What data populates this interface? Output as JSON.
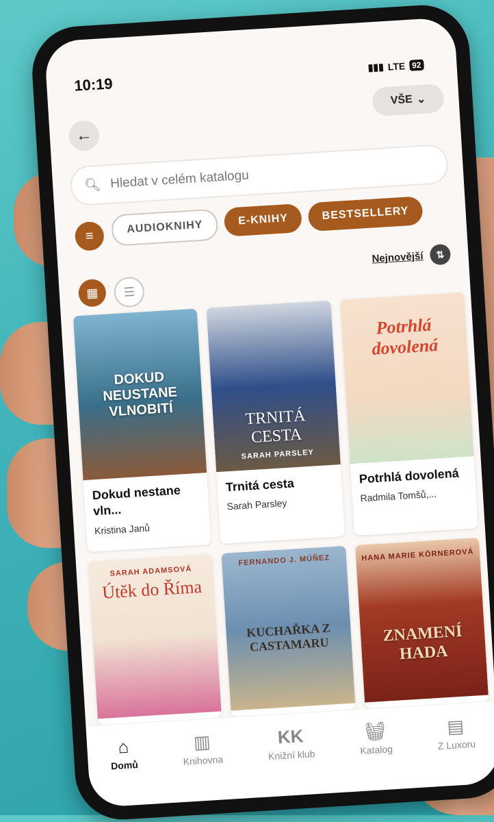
{
  "status": {
    "time": "10:19",
    "network": "LTE",
    "battery": "92"
  },
  "header": {
    "filter_scope": "VŠE"
  },
  "search": {
    "placeholder": "Hledat v celém katalogu"
  },
  "chips": [
    {
      "label": "AUDIOKNIHY",
      "active": false
    },
    {
      "label": "E-KNIHY",
      "active": true
    },
    {
      "label": "BESTSELLERY",
      "active": true
    }
  ],
  "sort": {
    "label": "Nejnovější"
  },
  "books": [
    {
      "title": "Dokud nestane vln...",
      "author": "Kristina Janů",
      "cover_text": "DOKUD NEUSTANE VLNOBITÍ",
      "cover_author": "",
      "cover_color": "#3a6f8a"
    },
    {
      "title": "Trnitá cesta",
      "author": "Sarah Parsley",
      "cover_text": "TRNITÁ CESTA",
      "cover_author": "SARAH PARSLEY",
      "cover_color": "#4c5f7c"
    },
    {
      "title": "Potrhlá dovolená",
      "author": "Radmila Tomšů,...",
      "cover_text": "Potrhlá dovolená",
      "cover_author": "",
      "cover_color": "#f3d9c0"
    },
    {
      "title": "",
      "author": "",
      "cover_text": "Útěk do Říma",
      "cover_author": "SARAH ADAMSOVÁ",
      "cover_color": "#f1e3d2"
    },
    {
      "title": "",
      "author": "",
      "cover_text": "KUCHAŘKA Z CASTAMARU",
      "cover_author": "FERNANDO J. MÚÑEZ",
      "cover_color": "#6c8fb0"
    },
    {
      "title": "",
      "author": "",
      "cover_text": "ZNAMENÍ HADA",
      "cover_author": "HANA MARIE KÖRNEROVÁ",
      "cover_color": "#8c2a1e"
    }
  ],
  "nav": [
    {
      "label": "Domů",
      "icon": "home-icon",
      "active": true
    },
    {
      "label": "Knihovna",
      "icon": "library-icon",
      "active": false
    },
    {
      "label": "Knižní klub",
      "icon": "book-club-icon",
      "active": false
    },
    {
      "label": "Katalog",
      "icon": "basket-icon",
      "active": false
    },
    {
      "label": "Z Luxoru",
      "icon": "document-icon",
      "active": false
    }
  ],
  "colors": {
    "accent": "#a65a1d",
    "background": "#fbf7f4"
  }
}
